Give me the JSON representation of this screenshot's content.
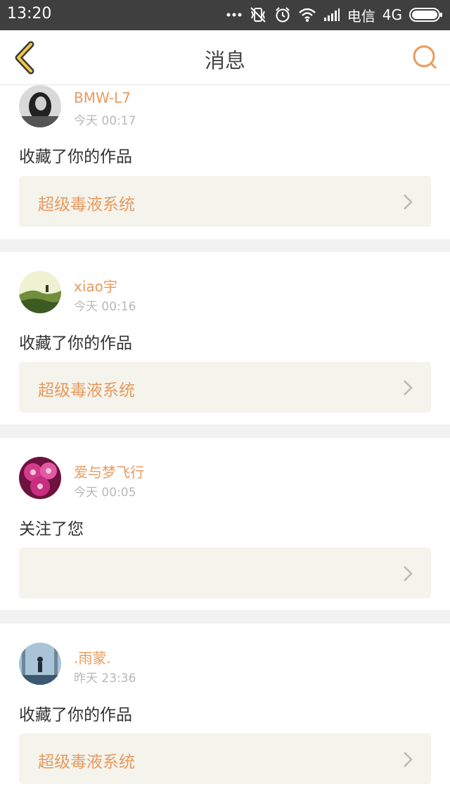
{
  "status_bar": {
    "time": "13:20",
    "carrier": "电信",
    "network": "4G"
  },
  "header": {
    "title": "消息"
  },
  "messages": [
    {
      "username": "BMW-L7",
      "time": "今天 00:17",
      "action": "收藏了你的作品",
      "work_title": "超级毒液系统"
    },
    {
      "username": "xiao宇",
      "time": "今天 00:16",
      "action": "收藏了你的作品",
      "work_title": "超级毒液系统"
    },
    {
      "username": "爱与梦飞行",
      "time": "今天 00:05",
      "action": "关注了您",
      "work_title": ""
    },
    {
      "username": ".雨蒙.",
      "time": "昨天 23:36",
      "action": "收藏了你的作品",
      "work_title": "超级毒液系统"
    }
  ],
  "colors": {
    "accent": "#e89a5e",
    "status_bar": "#3f3f3f",
    "work_box": "#f4f3ec"
  }
}
